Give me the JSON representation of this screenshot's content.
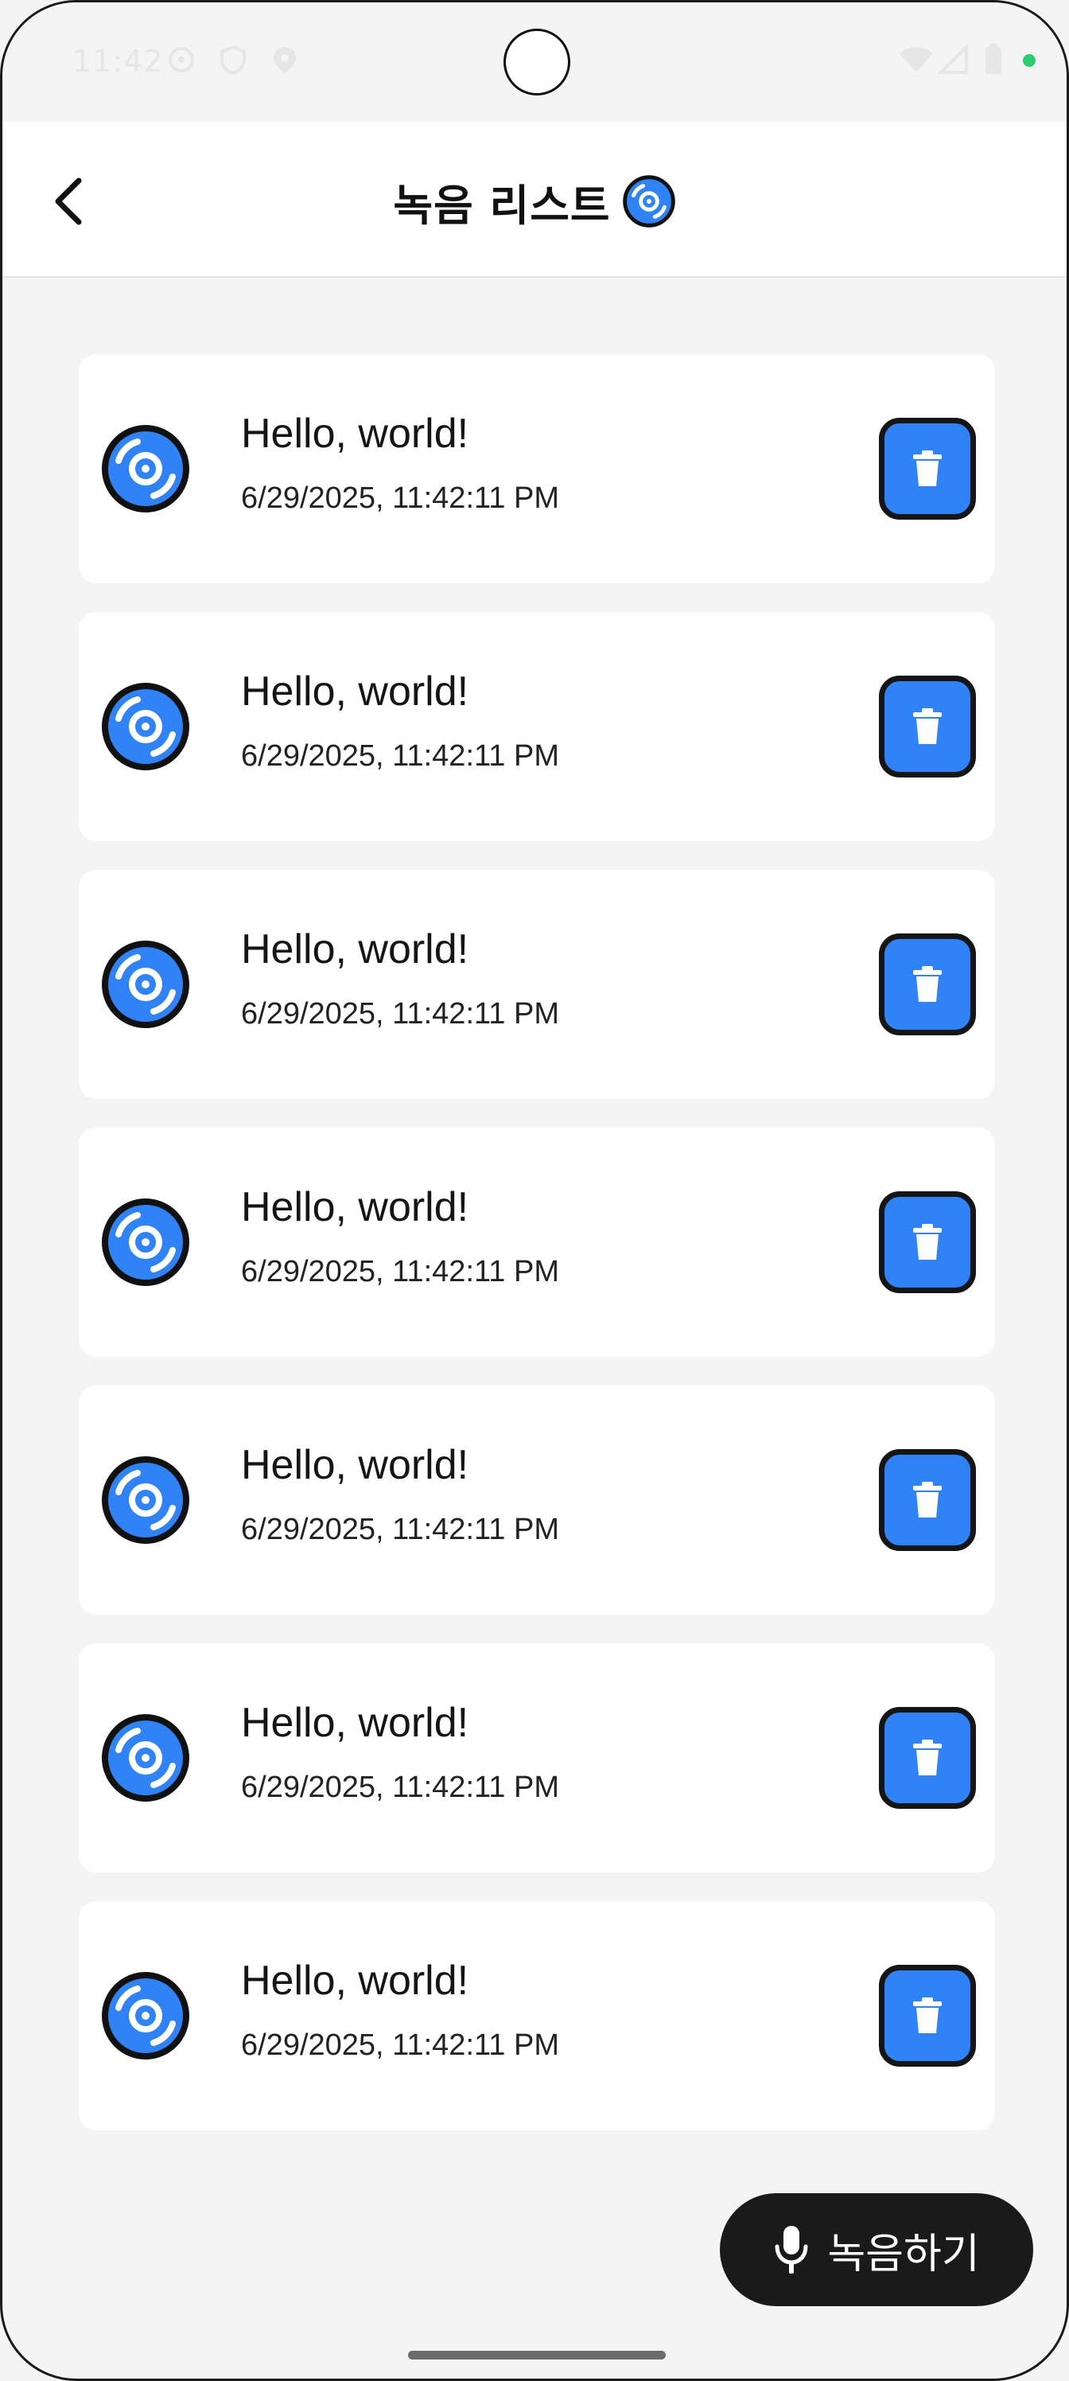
{
  "status_bar": {
    "time": "11:42",
    "icons": [
      "sync-icon",
      "shield-icon",
      "location-icon",
      "wifi-icon",
      "signal-icon",
      "battery-icon"
    ],
    "dot_color": "#2ecc71"
  },
  "app_bar": {
    "title": "녹음 리스트",
    "back_icon": "chevron-left-icon",
    "title_icon": "disc-icon"
  },
  "recordings": [
    {
      "title": "Hello, world!",
      "date": "6/29/2025, 11:42:11 PM"
    },
    {
      "title": "Hello, world!",
      "date": "6/29/2025, 11:42:11 PM"
    },
    {
      "title": "Hello, world!",
      "date": "6/29/2025, 11:42:11 PM"
    },
    {
      "title": "Hello, world!",
      "date": "6/29/2025, 11:42:11 PM"
    },
    {
      "title": "Hello, world!",
      "date": "6/29/2025, 11:42:11 PM"
    },
    {
      "title": "Hello, world!",
      "date": "6/29/2025, 11:42:11 PM"
    },
    {
      "title": "Hello, world!",
      "date": "6/29/2025, 11:42:11 PM"
    }
  ],
  "record_button": {
    "label": "녹음하기",
    "icon": "microphone-icon"
  },
  "colors": {
    "accent": "#2f83f6",
    "dark": "#1a1a1a",
    "background": "#f4f4f4"
  }
}
